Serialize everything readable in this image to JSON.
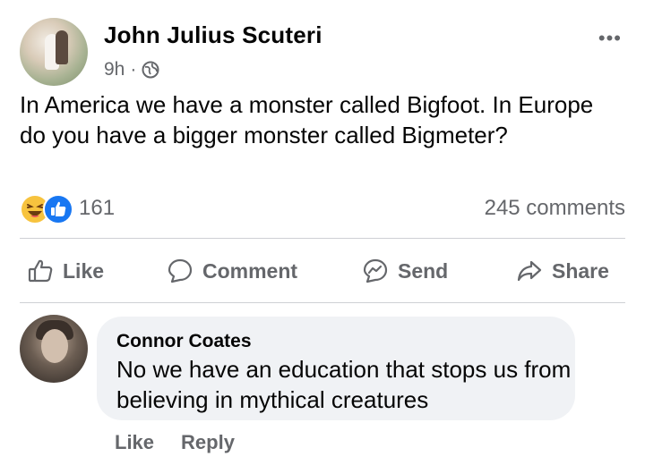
{
  "post": {
    "author": "John Julius Scuteri",
    "time": "9h",
    "separator": "·",
    "more": "•••",
    "text": "In America we have a monster called Bigfoot. In Europe do you have a bigger monster called Bigmeter?"
  },
  "reactions": {
    "count": "161"
  },
  "comments_summary": {
    "count_label": "245 comments"
  },
  "actions": {
    "like": "Like",
    "comment": "Comment",
    "send": "Send",
    "share": "Share"
  },
  "comment": {
    "author": "Connor Coates",
    "text": "No we have an education that stops us from believing in mythical creatures",
    "like": "Like",
    "reply": "Reply"
  },
  "colors": {
    "secondary_text": "#65676b",
    "bubble": "#f0f2f5",
    "like_blue": "#1877f2",
    "haha_yellow": "#f7c33e"
  },
  "icons": [
    "more-icon",
    "globe-icon",
    "haha-icon",
    "like-reaction-icon",
    "like-icon",
    "comment-icon",
    "send-icon",
    "share-icon"
  ]
}
